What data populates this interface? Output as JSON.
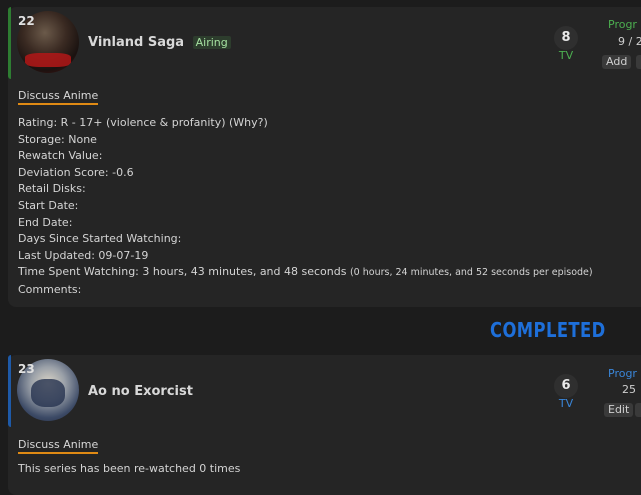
{
  "entries": [
    {
      "rank": "22",
      "title": "Vinland Saga",
      "status_badge": "Airing",
      "score": "8",
      "type": "TV",
      "progress_label": "Progr",
      "progress_value": "9 / 2",
      "add_label": "Add",
      "discuss_label": "Discuss Anime",
      "details": {
        "rating": "Rating: R - 17+ (violence & profanity) (Why?)",
        "storage": "Storage: None",
        "rewatch": "Rewatch Value:",
        "deviation": "Deviation Score: -0.6",
        "retail": "Retail Disks:",
        "start": "Start Date:",
        "end": "End Date:",
        "days": "Days Since Started Watching:",
        "updated": "Last Updated: 09-07-19",
        "time_spent": "Time Spent Watching: 3 hours, 43 minutes, and 48 seconds",
        "time_per_episode": "(0 hours, 24 minutes, and 52 seconds per episode)",
        "comments": "Comments:"
      }
    },
    {
      "rank": "23",
      "title": "Ao no Exorcist",
      "score": "6",
      "type": "TV",
      "progress_label": "Progr",
      "progress_value": "25",
      "edit_label": "Edit",
      "discuss_label": "Discuss Anime",
      "rewatch_note": "This series has been re-watched 0 times"
    }
  ],
  "section_heading": "COMPLETED",
  "colors": {
    "background": "#1c1c1c",
    "card": "#252525",
    "watching_accent": "#4caf50",
    "completed_accent": "#1e6fd9",
    "discuss_underline": "#e08a14"
  }
}
